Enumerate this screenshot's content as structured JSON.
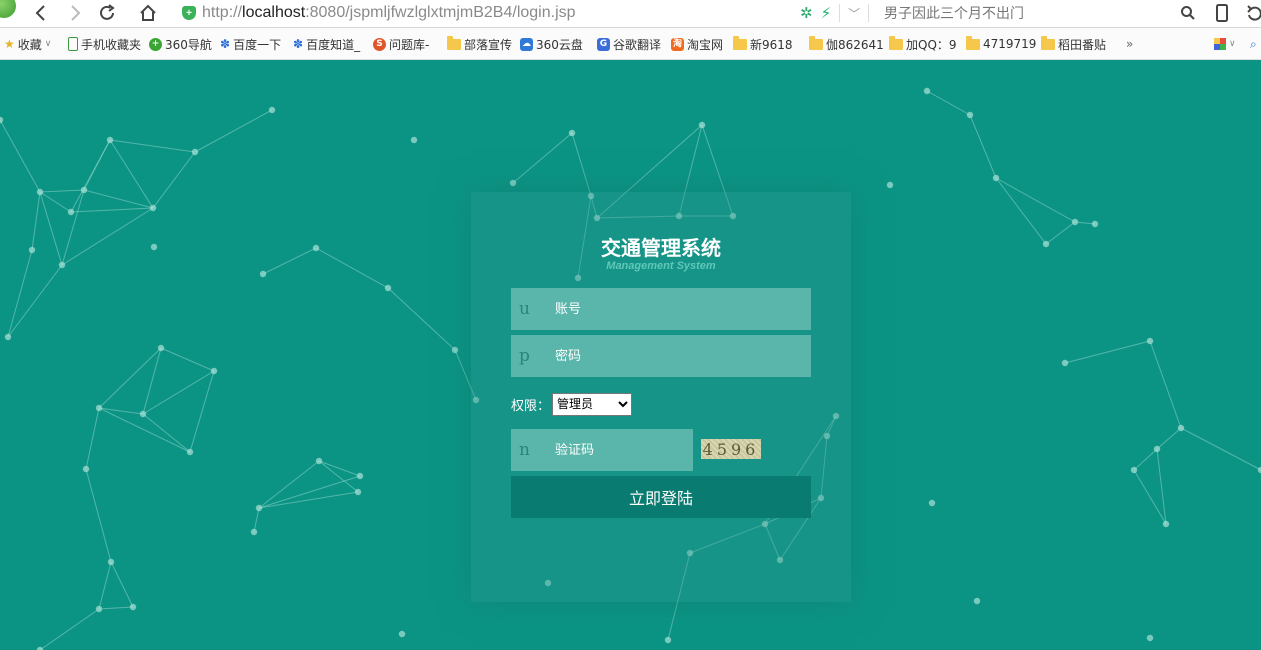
{
  "browser": {
    "url_prefix": "http://",
    "url_host": "localhost",
    "url_path": ":8080/jspmljfwzlglxtmjmB2B4/login.jsp",
    "search_text": "男子因此三个月不出门",
    "bookmarks": [
      {
        "label": "收藏",
        "icon": "star-icon"
      },
      {
        "label": "手机收藏夹",
        "icon": "phone-icon"
      },
      {
        "label": "360导航",
        "icon": "360-icon"
      },
      {
        "label": "百度一下",
        "icon": "baidu-paw-icon"
      },
      {
        "label": "百度知道_",
        "icon": "baidu-paw-icon"
      },
      {
        "label": "问题库-",
        "icon": "s-circle-icon"
      },
      {
        "label": "部落宣传",
        "icon": "folder-icon"
      },
      {
        "label": "360云盘",
        "icon": "cloud-icon"
      },
      {
        "label": "谷歌翻译",
        "icon": "translate-icon"
      },
      {
        "label": "淘宝网",
        "icon": "taobao-icon"
      },
      {
        "label": "新9618",
        "icon": "folder-icon"
      },
      {
        "label": "伽862641",
        "icon": "folder-icon"
      },
      {
        "label": "加QQ：9",
        "icon": "folder-icon"
      },
      {
        "label": "4719719",
        "icon": "folder-icon"
      },
      {
        "label": "稻田番贴",
        "icon": "folder-icon"
      }
    ],
    "more_label": "»"
  },
  "login": {
    "title": "交通管理系统",
    "subtitle": "Management System",
    "username_letter": "u",
    "username_placeholder": "账号",
    "password_letter": "p",
    "password_placeholder": "密码",
    "role_label": "权限：",
    "role_selected": "管理员",
    "captcha_letter": "n",
    "captcha_placeholder": "验证码",
    "captcha_code": "4596",
    "submit_label": "立即登陆"
  },
  "colors": {
    "background": "#0b9484",
    "field": "#5ab5ab",
    "button": "#0a7b70"
  }
}
